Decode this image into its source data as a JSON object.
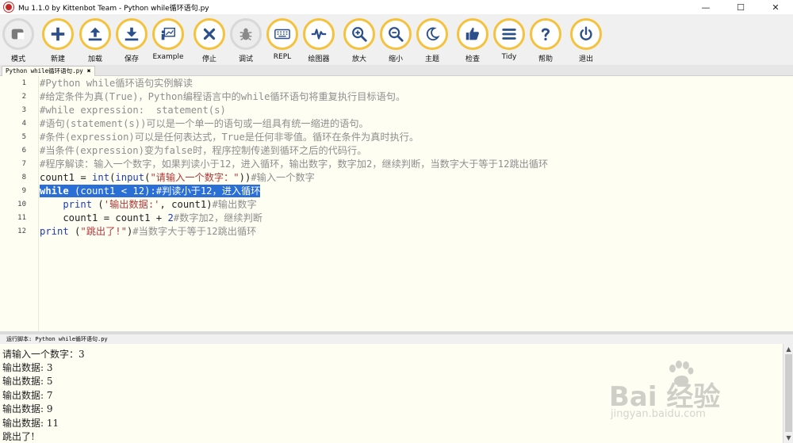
{
  "window": {
    "title": "Mu 1.1.0 by Kittenbot Team - Python while循环语句.py",
    "minimize": "—",
    "maximize": "☐",
    "close": "✕"
  },
  "toolbar": {
    "buttons": [
      {
        "id": "mode",
        "label": "模式",
        "icon": "mode-icon"
      },
      {
        "id": "new",
        "label": "新建",
        "icon": "plus-icon"
      },
      {
        "id": "load",
        "label": "加载",
        "icon": "upload-icon"
      },
      {
        "id": "save",
        "label": "保存",
        "icon": "download-icon"
      },
      {
        "id": "example",
        "label": "Example",
        "icon": "presentation-icon"
      },
      {
        "id": "stop",
        "label": "停止",
        "icon": "close-icon"
      },
      {
        "id": "debug",
        "label": "调试",
        "icon": "bug-icon"
      },
      {
        "id": "repl",
        "label": "REPL",
        "icon": "keyboard-icon"
      },
      {
        "id": "plotter",
        "label": "绘图器",
        "icon": "pulse-icon"
      },
      {
        "id": "zoom-in",
        "label": "放大",
        "icon": "zoom-in-icon"
      },
      {
        "id": "zoom-out",
        "label": "缩小",
        "icon": "zoom-out-icon"
      },
      {
        "id": "theme",
        "label": "主题",
        "icon": "moon-icon"
      },
      {
        "id": "check",
        "label": "检查",
        "icon": "thumbs-up-icon"
      },
      {
        "id": "tidy",
        "label": "Tidy",
        "icon": "lines-icon"
      },
      {
        "id": "help",
        "label": "帮助",
        "icon": "question-icon"
      },
      {
        "id": "quit",
        "label": "退出",
        "icon": "power-icon"
      }
    ],
    "accent": "#f5c23d"
  },
  "tab": {
    "label": "Python while循环语句.py",
    "close": "✖"
  },
  "editor": {
    "lines": [
      {
        "n": "1"
      },
      {
        "n": "2"
      },
      {
        "n": "3"
      },
      {
        "n": "4"
      },
      {
        "n": "5"
      },
      {
        "n": "6"
      },
      {
        "n": "7"
      },
      {
        "n": "8"
      },
      {
        "n": "9"
      },
      {
        "n": "10"
      },
      {
        "n": "11"
      },
      {
        "n": "12"
      }
    ],
    "code": {
      "l1": "#Python while循环语句实例解读",
      "l2": "#给定条件为真(True)，Python编程语言中的while循环语句将重复执行目标语句。",
      "l3": "#while expression:  statement(s)",
      "l4": "#语句(statement(s))可以是一个单一的语句或一组具有统一缩进的语句。",
      "l5": "#条件(expression)可以是任何表达式，True是任何非零值。循环在条件为真时执行。",
      "l6": "#当条件(expression)变为false时，程序控制传递到循环之后的代码行。",
      "l7": "#程序解读：输入一个数字，如果判读小于12，进入循环，输出数字，数字加2，继续判断，当数字大于等于12跳出循环",
      "l8a": "count1 = ",
      "l8b": "int",
      "l8c": "(",
      "l8d": "input",
      "l8e": "(",
      "l8f": "\"请输入一个数字：\"",
      "l8g": "))",
      "l8h": "#输入一个数字",
      "l9a": "while",
      "l9b": " (count1 < 12):",
      "l9c": "#判读小于12，进入循环",
      "l10a": "    print",
      "l10b": " (",
      "l10c": "'输出数据:'",
      "l10d": ", count1)",
      "l10e": "#输出数字",
      "l11a": "    count1 = count1 + ",
      "l11b": "2",
      "l11c": "#数字加2，继续判断",
      "l12a": "print",
      "l12b": " (",
      "l12c": "\"跳出了!\"",
      "l12d": ")",
      "l12e": "#当数字大于等于12跳出循环"
    },
    "colors": {
      "keyword": "#1f3bb8",
      "string": "#b03838",
      "comment": "#8e8e8e",
      "selection": "#2a6fd6",
      "background": "#fefef3"
    }
  },
  "repl": {
    "header": "运行脚本: Python while循环语句.py",
    "lines": [
      "请输入一个数字：3",
      "输出数据: 3",
      "输出数据: 5",
      "输出数据: 7",
      "输出数据: 9",
      "输出数据: 11",
      "跳出了!"
    ],
    "scroll_up": "▲",
    "scroll_down": "▼"
  },
  "watermark": {
    "brand": "Bai  经验",
    "url": "jingyan.baidu.com"
  }
}
